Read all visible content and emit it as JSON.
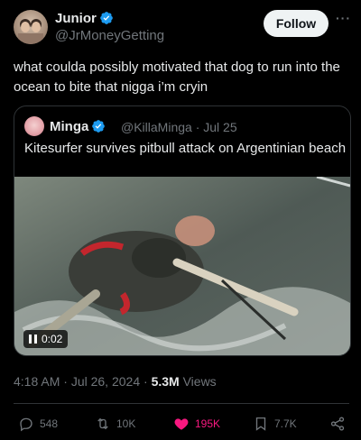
{
  "author": {
    "name": "Junior",
    "handle": "@JrMoneyGetting"
  },
  "follow_label": "Follow",
  "post_text": "what coulda possibly motivated that dog to run into the ocean to bite that nigga i’m cryin",
  "quoted": {
    "name": "Minga",
    "handle": "@KillaMinga",
    "date": "Jul 25",
    "text": "Kitesurfer survives pitbull attack on Argentinian beach",
    "video_time": "0:02"
  },
  "meta": {
    "time": "4:18 AM",
    "date": "Jul 26, 2024",
    "views": "5.3M",
    "views_label": "Views"
  },
  "actions": {
    "replies": "548",
    "reposts": "10K",
    "likes": "195K",
    "bookmarks": "7.7K"
  },
  "colors": {
    "background": "#000000",
    "text": "#e7e9ea",
    "secondary_text": "#71767b",
    "verified": "#1d9bf0",
    "like": "#f91880",
    "border": "#2f3336"
  }
}
